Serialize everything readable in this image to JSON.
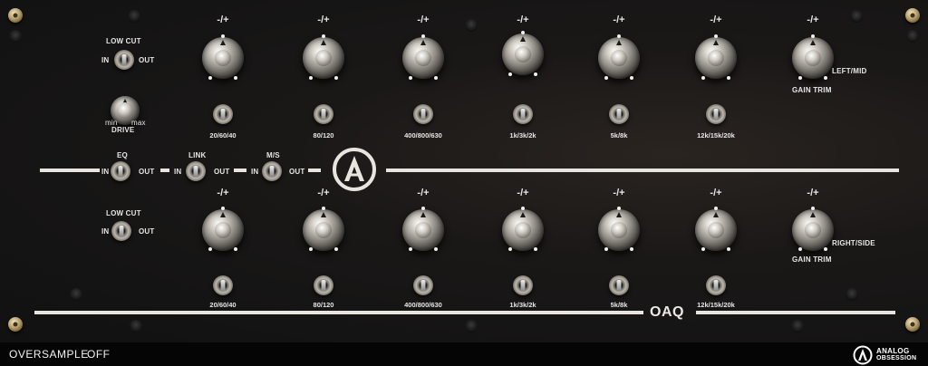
{
  "plus_minus": "-/+",
  "top_bands": [
    "20/60/40",
    "80/120",
    "400/800/630",
    "1k/3k/2k",
    "5k/8k",
    "12k/15k/20k"
  ],
  "bottom_bands": [
    "20/60/40",
    "80/120",
    "400/800/630",
    "1k/3k/2k",
    "5k/8k",
    "12k/15k/20k"
  ],
  "lowcut_label": "LOW CUT",
  "in_label": "IN",
  "out_label": "OUT",
  "drive": {
    "min": "min",
    "max": "max",
    "label": "DRIVE"
  },
  "eq_label": "EQ",
  "link_label": "LINK",
  "ms_label": "M/S",
  "gain_trim": "GAIN TRIM",
  "left_mid": "LEFT/MID",
  "right_side": "RIGHT/SIDE",
  "model": "OAQ",
  "brand_line1": "ANALOG",
  "brand_line2": "OBSESSION",
  "footer": {
    "oversample_label": "OVERSAMPLE",
    "oversample_value": "OFF"
  }
}
